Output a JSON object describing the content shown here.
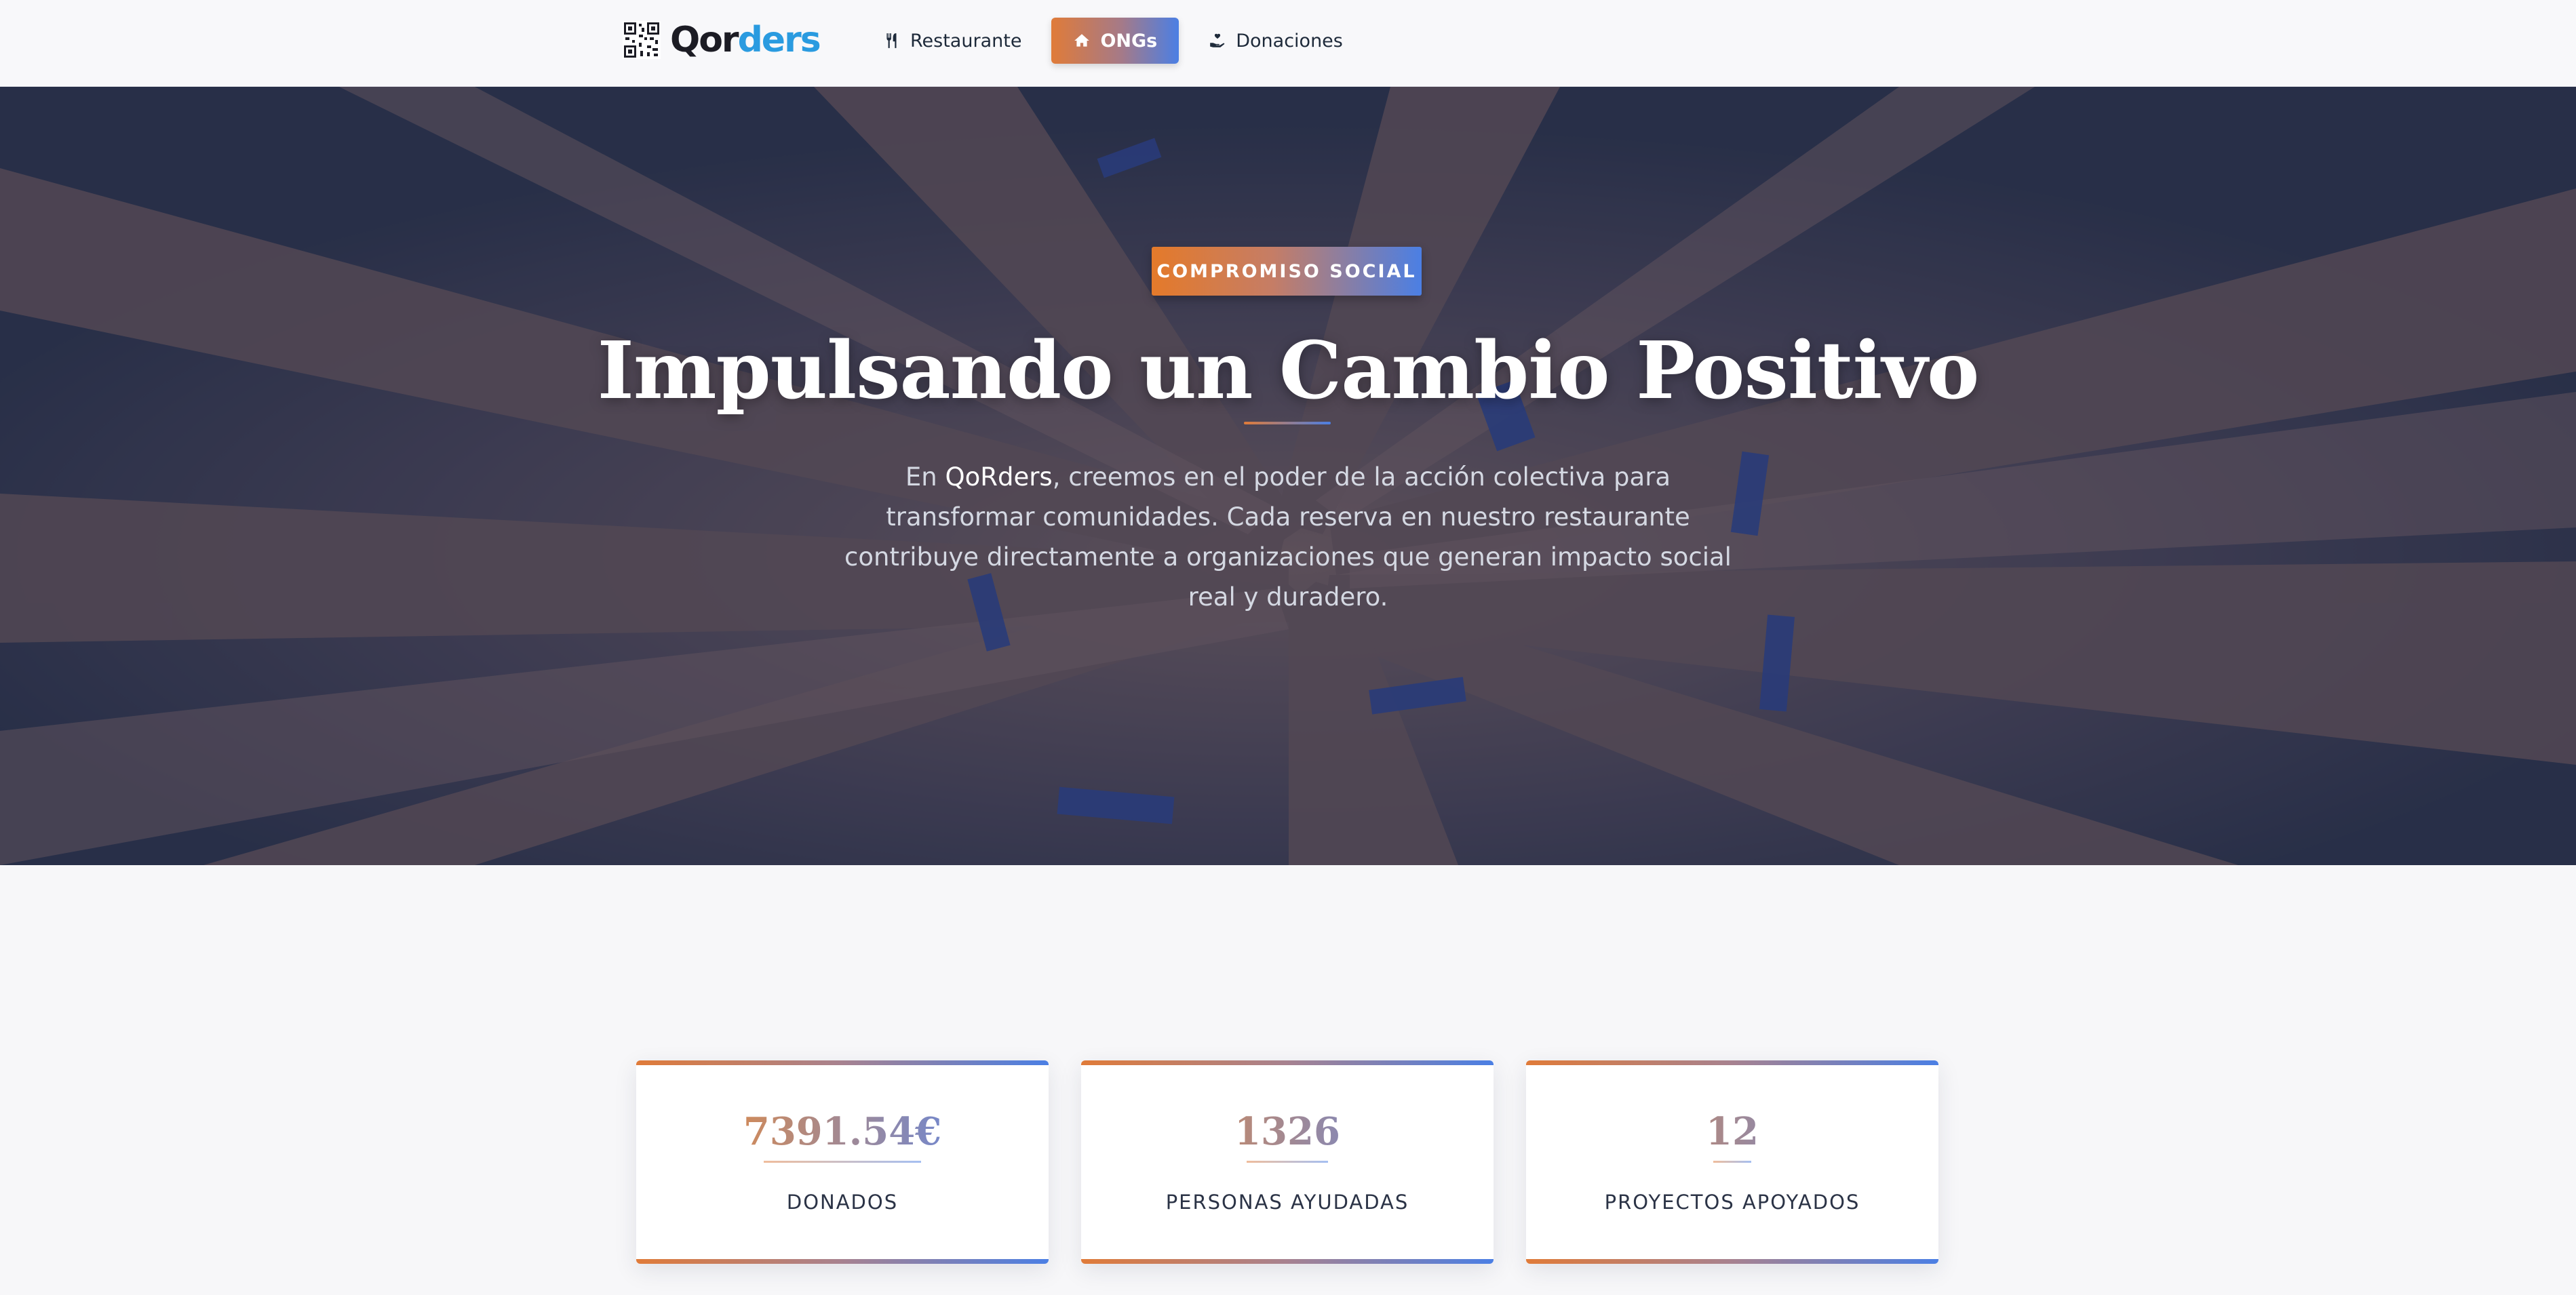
{
  "brand": {
    "name_part1": "Qor",
    "name_part2": "ders",
    "logo_icon": "qr-code-icon"
  },
  "nav": {
    "items": [
      {
        "label": "Restaurante",
        "icon": "utensils-icon",
        "active": false
      },
      {
        "label": "ONGs",
        "icon": "home-icon",
        "active": true
      },
      {
        "label": "Donaciones",
        "icon": "hand-holding-heart-icon",
        "active": false
      }
    ]
  },
  "hero": {
    "badge": "COMPROMISO SOCIAL",
    "title": "Impulsando un Cambio Positivo",
    "text_prefix": "En ",
    "text_highlight": "QoRders",
    "text_suffix": ", creemos en el poder de la acción colectiva para transformar comunidades. Cada reserva en nuestro restaurante contribuye directamente a organizaciones que generan impacto social real y duradero."
  },
  "stats": [
    {
      "value": "7391.54€",
      "label": "DONADOS"
    },
    {
      "value": "1326",
      "label": "PERSONAS AYUDADAS"
    },
    {
      "value": "12",
      "label": "PROYECTOS APOYADOS"
    }
  ],
  "colors": {
    "accent_orange": "#e07b39",
    "accent_blue": "#4b7fe4",
    "brand_blue": "#2a9be0",
    "text_dark": "#1e2a3a"
  }
}
